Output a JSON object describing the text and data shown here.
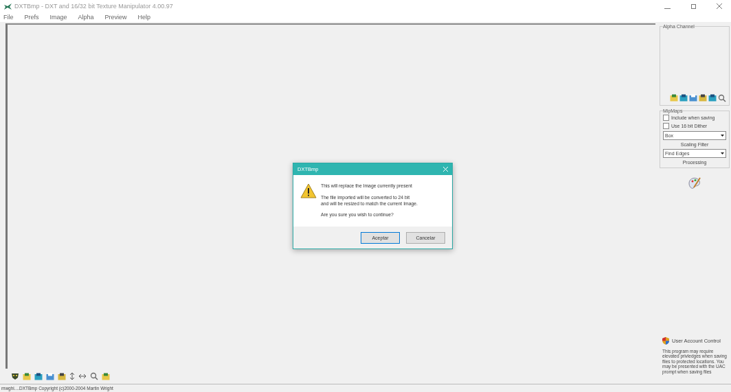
{
  "window": {
    "title": "DXTBmp - DXT and 16/32 bit Texture Manipulator  4.00.97"
  },
  "menu": [
    "File",
    "Prefs",
    "Image",
    "Alpha",
    "Preview",
    "Help"
  ],
  "alpha_channel": {
    "title": "Alpha Channel"
  },
  "mipmaps": {
    "title": "MipMaps",
    "checkboxes": [
      {
        "label": "Include when saving",
        "checked": false
      },
      {
        "label": "Use 16 bit Dither",
        "checked": false
      }
    ],
    "selects": [
      {
        "value": "Box",
        "caption": "Scaling Filter"
      },
      {
        "value": "Find Edges",
        "caption": "Processing"
      }
    ]
  },
  "uac": {
    "title": "User Account Control",
    "text": "This program may require elevated privledges when saving files to protected locations. You may be presented with the UAC prompt when saving files"
  },
  "dialog": {
    "title": "DXTBmp",
    "lines": [
      "This will replace the  Image currently present",
      "The file imported will be converted to 24 bit\nand will be resized to match the current Image.",
      "Are you sure you wish to continue?"
    ],
    "buttons": [
      {
        "label": "Aceptar",
        "selected": true
      },
      {
        "label": "Cancelar",
        "selected": false
      }
    ]
  },
  "status_bar": "mwghi....DXTBmp Copyright (c)2000-2004 Martin Wright"
}
